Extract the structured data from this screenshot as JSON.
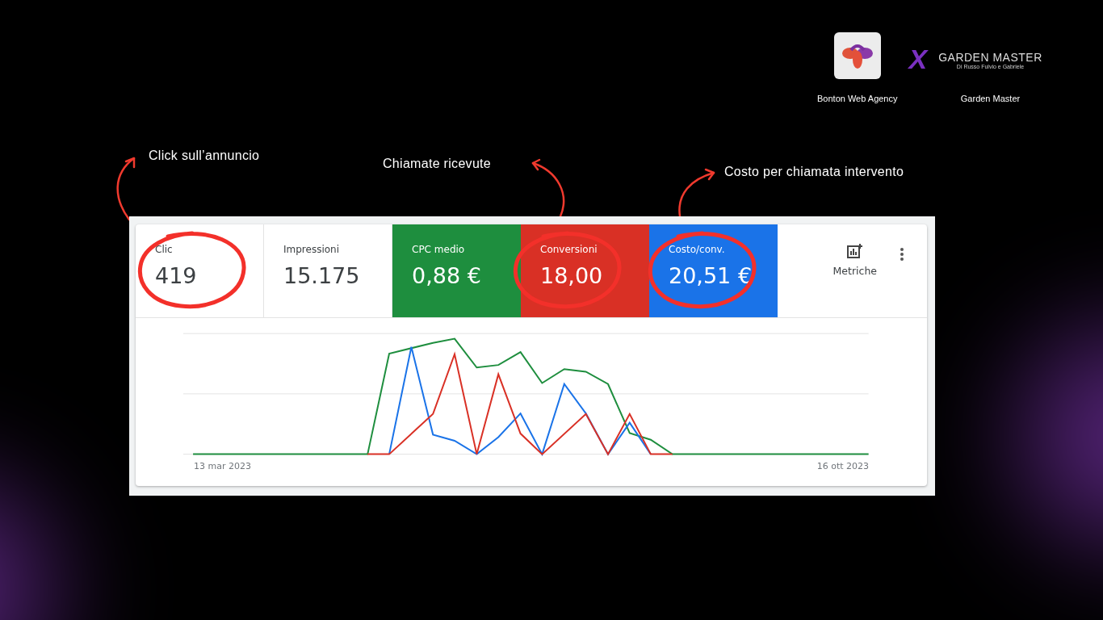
{
  "partners": [
    {
      "kind": "agency",
      "name": "Bonton Web Agency"
    },
    {
      "kind": "client",
      "name": "Garden Master",
      "logo_title": "GARDEN MASTER",
      "logo_subtitle": "Di Russo Fulvio e Gabriele"
    }
  ],
  "separator": "X",
  "annotations": [
    {
      "text": "Click sull’annuncio"
    },
    {
      "text": "Chiamate ricevute"
    },
    {
      "text": "Costo per chiamata intervento"
    }
  ],
  "metrics": [
    {
      "label": "Clic",
      "value": "419",
      "selected": false,
      "circled": true
    },
    {
      "label": "Impressioni",
      "value": "15.175",
      "selected": false,
      "circled": false
    },
    {
      "label": "CPC medio",
      "value": "0,88 €",
      "selected": true,
      "color": "#1e8e3e",
      "circled": false
    },
    {
      "label": "Conversioni",
      "value": "18,00",
      "selected": true,
      "color": "#d93025",
      "circled": true
    },
    {
      "label": "Costo/conv.",
      "value": "20,51 €",
      "selected": true,
      "color": "#1a73e8",
      "circled": true
    }
  ],
  "metrics_button": {
    "label": "Metriche"
  },
  "chart": {
    "start_label": "13 mar 2023",
    "end_label": "16 ott 2023"
  }
}
